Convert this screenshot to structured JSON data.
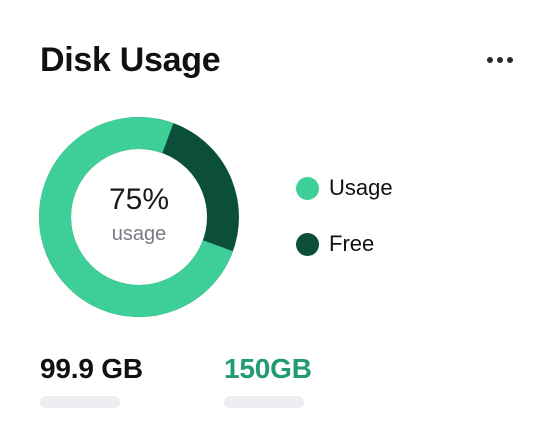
{
  "widget": {
    "title": "Disk Usage",
    "menu_icon": "more-horizontal-icon"
  },
  "donut": {
    "percent_label": "75%",
    "sub_label": "usage",
    "usage_fraction": 0.75,
    "colors": {
      "usage": "#3ecf98",
      "free": "#0b4f3a"
    }
  },
  "legend": [
    {
      "label": "Usage",
      "color": "#3ecf98"
    },
    {
      "label": "Free",
      "color": "#0b4f3a"
    }
  ],
  "stats": {
    "used": "99.9 GB",
    "total": "150GB",
    "total_color": "#239b72"
  }
}
